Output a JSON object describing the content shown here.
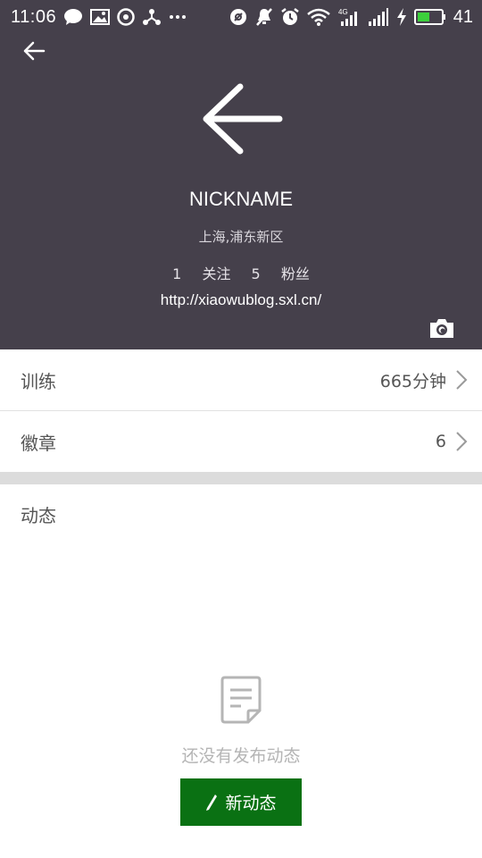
{
  "status_bar": {
    "time": "11:06",
    "battery_level": "41",
    "network_label": "4G"
  },
  "profile": {
    "nickname": "NICKNAME",
    "location": "上海,浦东新区",
    "following_count": "1",
    "following_label": "关注",
    "followers_count": "5",
    "followers_label": "粉丝",
    "url": "http://xiaowublog.sxl.cn/"
  },
  "rows": [
    {
      "label": "训练",
      "value": "665分钟"
    },
    {
      "label": "徽章",
      "value": "6"
    }
  ],
  "feed": {
    "title": "动态",
    "empty_text": "还没有发布动态",
    "new_button_label": "新动态"
  },
  "colors": {
    "header_bg": "#45404b",
    "accent_green": "#0a7113",
    "divider": "#e2e2e2"
  },
  "icons": {
    "back": "arrow-left-icon",
    "camera": "camera-icon",
    "chevron": "chevron-right-icon",
    "empty": "document-icon",
    "pencil": "pencil-icon"
  }
}
